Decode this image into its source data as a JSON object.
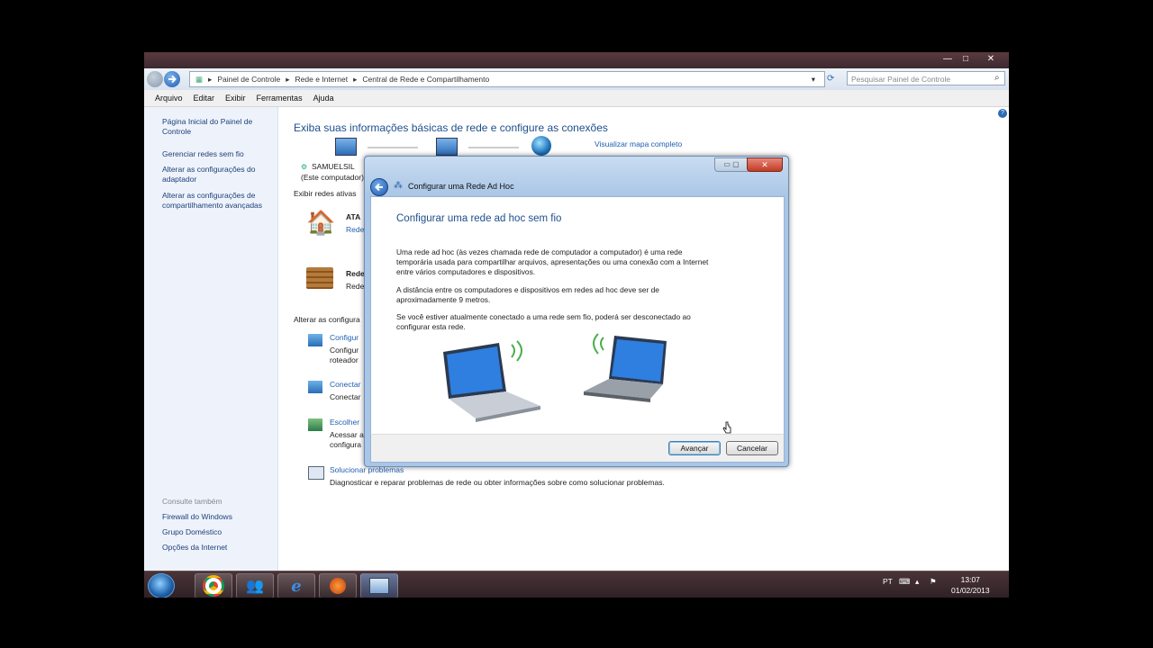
{
  "window": {
    "min": "—",
    "max": "□",
    "close": "✕"
  },
  "address": {
    "crumbs": [
      "Painel de Controle",
      "Rede e Internet",
      "Central de Rede e Compartilhamento"
    ],
    "search_placeholder": "Pesquisar Painel de Controle"
  },
  "menu": [
    "Arquivo",
    "Editar",
    "Exibir",
    "Ferramentas",
    "Ajuda"
  ],
  "sidebar": {
    "home": "Página Inicial do Painel de Controle",
    "links": [
      "Gerenciar redes sem fio",
      "Alterar as configurações do adaptador",
      "Alterar as configurações de compartilhamento avançadas"
    ],
    "see_also": "Consulte também",
    "see_also_links": [
      "Firewall do Windows",
      "Grupo Doméstico",
      "Opções da Internet"
    ]
  },
  "main": {
    "title": "Exiba suas informações básicas de rede e configure as conexões",
    "full_map": "Visualizar mapa completo",
    "computer": "SAMUELSIL",
    "computer_sub": "(Este computador)",
    "active_networks": "Exibir redes ativas",
    "net1_name": "ATA",
    "net1_type": "Rede",
    "net2_name": "Rede",
    "net2_type": "Rede",
    "change_settings": "Alterar as configura",
    "tasks": [
      {
        "link": "Configur",
        "desc1": "Configur",
        "desc2": "roteador"
      },
      {
        "link": "Conectar",
        "desc1": "Conectar",
        "desc2": ""
      },
      {
        "link": "Escolher",
        "desc1": "Acessar a",
        "desc2": "configura"
      }
    ],
    "troubleshoot": "Solucionar problemas",
    "troubleshoot_desc": "Diagnosticar e reparar problemas de rede ou obter informações sobre como solucionar problemas."
  },
  "dialog": {
    "title": "Configurar uma Rede Ad Hoc",
    "heading": "Configurar uma rede ad hoc sem fio",
    "p1": "Uma rede ad hoc (às vezes chamada rede de computador a computador) é uma rede temporária usada para compartilhar arquivos, apresentações ou uma conexão com a Internet entre vários computadores e dispositivos.",
    "p2": "A distância entre os computadores e dispositivos em redes ad hoc deve ser de aproximadamente 9 metros.",
    "p3": "Se você estiver atualmente conectado a uma rede sem fio, poderá ser desconectado ao configurar esta rede.",
    "next": "Avançar",
    "cancel": "Cancelar"
  },
  "taskbar": {
    "lang": "PT",
    "time": "13:07",
    "date": "01/02/2013"
  }
}
